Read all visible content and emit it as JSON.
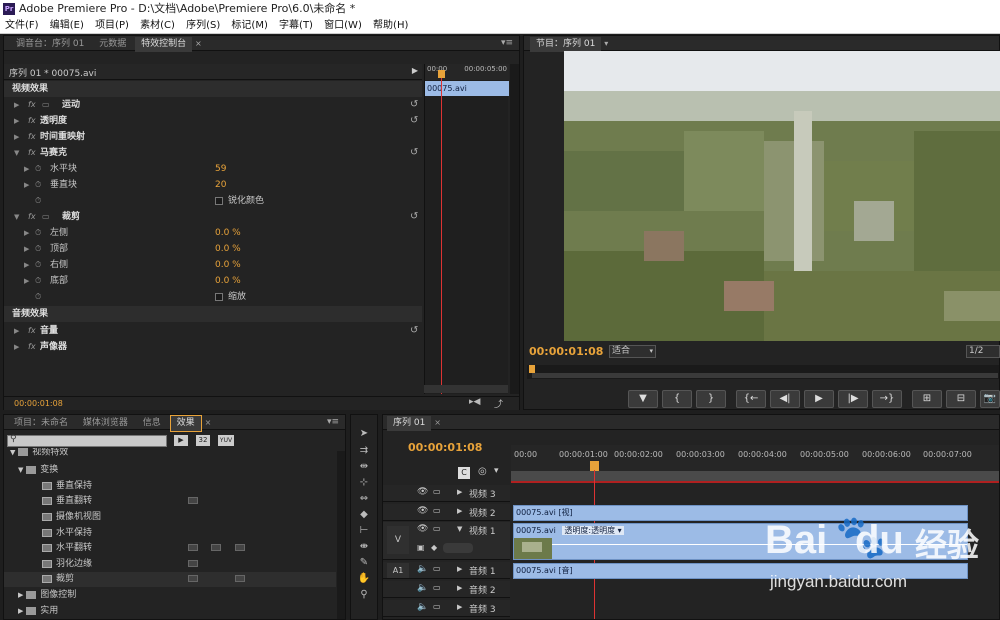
{
  "titlebar": {
    "title": "Adobe Premiere Pro - D:\\文档\\Adobe\\Premiere Pro\\6.0\\未命名 *",
    "app_icon": "Pr"
  },
  "menu": [
    "文件(F)",
    "编辑(E)",
    "项目(P)",
    "素材(C)",
    "序列(S)",
    "标记(M)",
    "字幕(T)",
    "窗口(W)",
    "帮助(H)"
  ],
  "effect_controls": {
    "tabs": [
      "调音台：序列 01",
      "元数据",
      "特效控制台"
    ],
    "header": "序列 01 * 00075.avi",
    "ruler_start": "00:00",
    "ruler_end": "00:00:05:00",
    "clip_label": "00075.avi",
    "video_section": "视频效果",
    "audio_section": "音频效果",
    "effects": {
      "motion": "运动",
      "opacity": "透明度",
      "time_remap": "时间重映射",
      "mosaic": "马赛克",
      "hblocks_label": "水平块",
      "hblocks_value": "59",
      "vblocks_label": "垂直块",
      "vblocks_value": "20",
      "sharpen": "锐化颜色",
      "crop": "裁剪",
      "left_label": "左侧",
      "left_value": "0.0 %",
      "top_label": "顶部",
      "top_value": "0.0 %",
      "right_label": "右侧",
      "right_value": "0.0 %",
      "bottom_label": "底部",
      "bottom_value": "0.0 %",
      "zoom": "缩放",
      "volume": "音量",
      "panner": "声像器"
    },
    "timecode": "00:00:01:08"
  },
  "program": {
    "tab": "节目：序列 01",
    "timecode": "00:00:01:08",
    "fit": "适合",
    "quality": "1/2"
  },
  "transport": [
    "▼",
    "{",
    "}",
    "{←",
    "◀|",
    "▶",
    "|▶",
    "→}",
    "⊞",
    "⊟",
    "📷"
  ],
  "project": {
    "tabs": [
      "项目：未命名",
      "媒体浏览器",
      "信息",
      "效果"
    ],
    "icon_labels": [
      "32",
      "YUV"
    ],
    "tree": {
      "video_effects": "视频特效",
      "transform": "变换",
      "items": [
        "垂直保持",
        "垂直翻转",
        "摄像机视图",
        "水平保持",
        "水平翻转",
        "羽化边缘",
        "裁剪"
      ],
      "image_control": "图像控制",
      "utility": "实用"
    }
  },
  "timeline": {
    "tab": "序列 01",
    "timecode": "00:00:01:08",
    "ruler": [
      "00:00",
      "00:00:01:00",
      "00:00:02:00",
      "00:00:03:00",
      "00:00:04:00",
      "00:00:05:00",
      "00:00:06:00",
      "00:00:07:00"
    ],
    "tracks": {
      "v3": "视频 3",
      "v2": "视频 2",
      "v1": "视频 1",
      "a1": "音频 1",
      "a2": "音频 2",
      "a3": "音频 3",
      "v_src": "V",
      "a_src": "A1"
    },
    "clips": {
      "v2": "00075.avi [视]",
      "v1": "00075.avi",
      "v1_fx": "透明度:透明度 ▾",
      "a1": "00075.avi [音]"
    }
  },
  "watermark": {
    "brand": "Bai",
    "brand2": "du",
    "cn": "经验",
    "url": "jingyan.baidu.com"
  }
}
